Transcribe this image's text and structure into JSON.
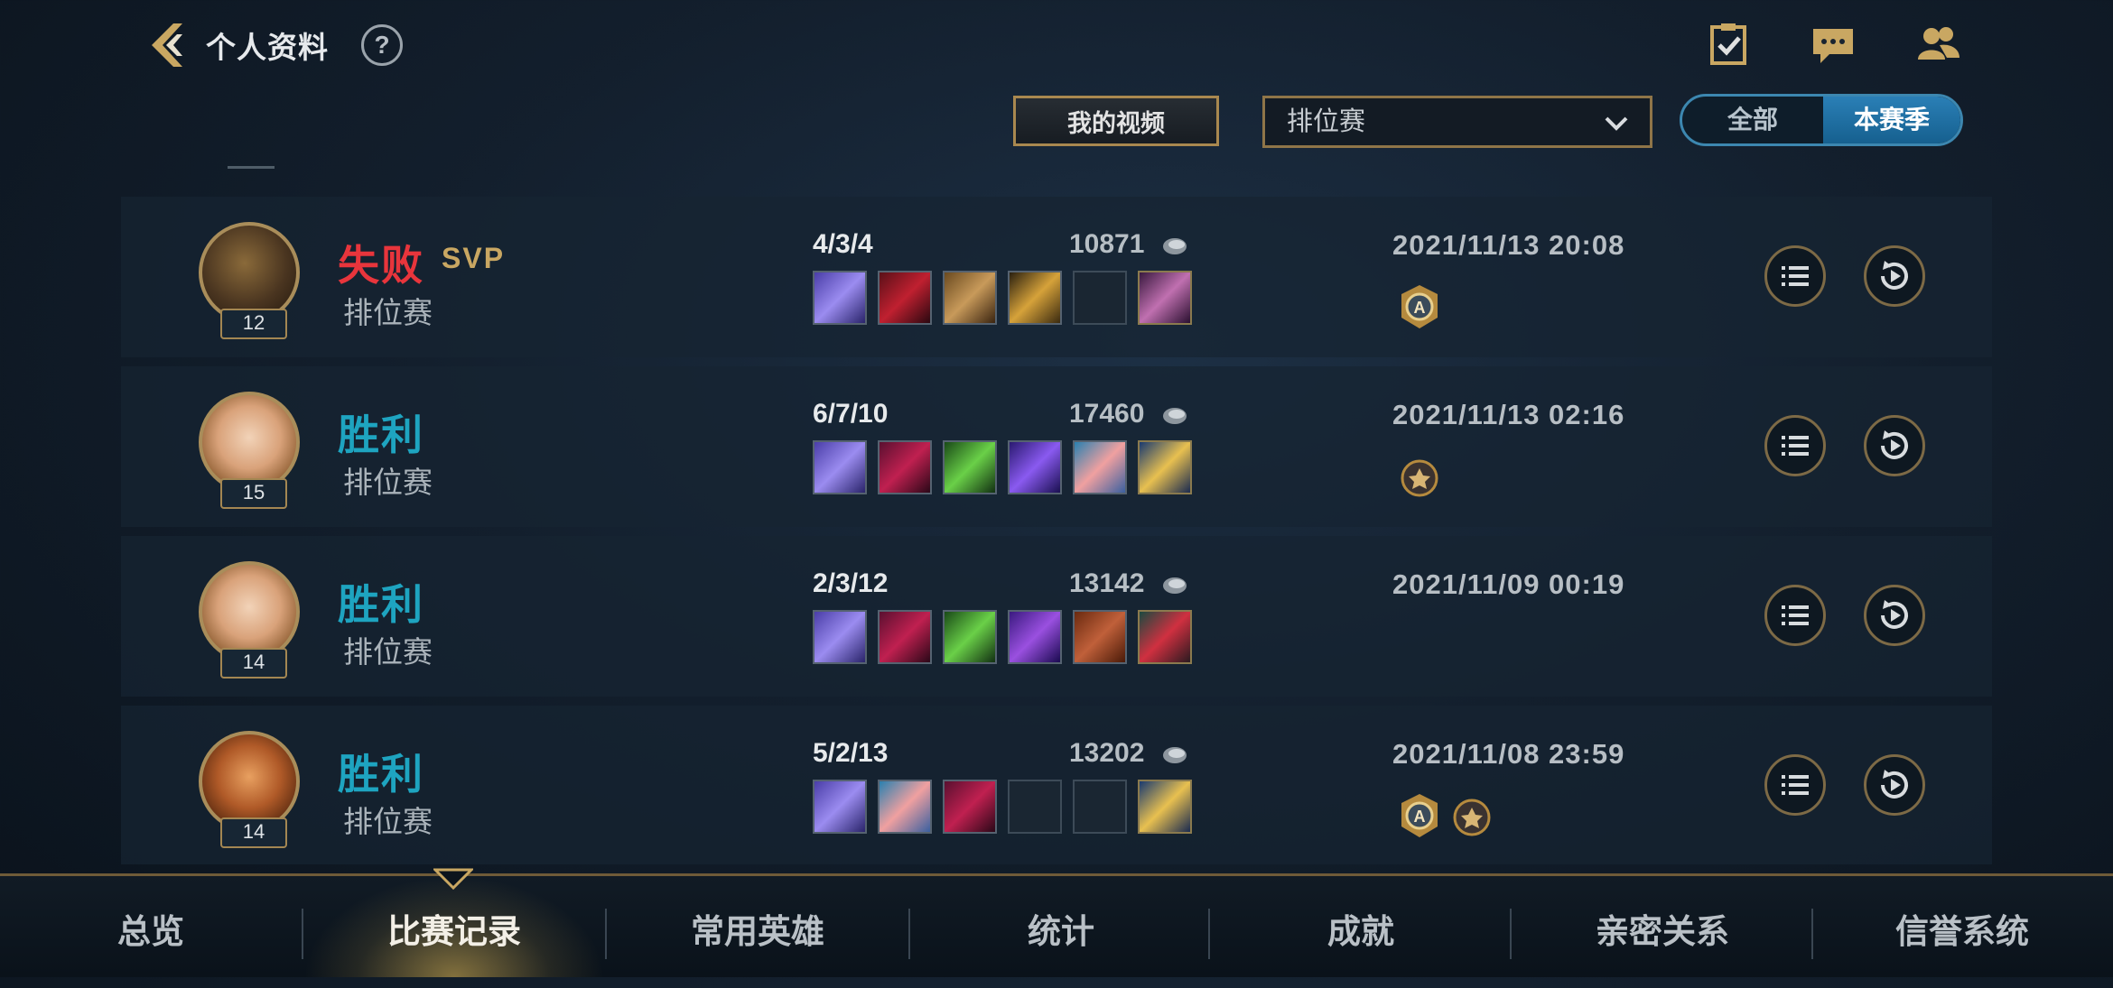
{
  "header": {
    "title": "个人资料",
    "help": "?",
    "my_video": "我的视频",
    "mode_select": "排位赛",
    "toggle": {
      "all": "全部",
      "season": "本赛季",
      "selected": "本赛季"
    }
  },
  "matches": [
    {
      "result": "失败",
      "svp": "SVP",
      "mode": "排位赛",
      "level": "12",
      "kda": "4/3/4",
      "gold": "10871",
      "datetime": "2021/11/13 20:08",
      "badges": [
        "rank-a-badge-icon"
      ]
    },
    {
      "result": "胜利",
      "mode": "排位赛",
      "level": "15",
      "kda": "6/7/10",
      "gold": "17460",
      "datetime": "2021/11/13 02:16",
      "badges": [
        "medal-badge-icon"
      ]
    },
    {
      "result": "胜利",
      "mode": "排位赛",
      "level": "14",
      "kda": "2/3/12",
      "gold": "13142",
      "datetime": "2021/11/09 00:19",
      "badges": []
    },
    {
      "result": "胜利",
      "mode": "排位赛",
      "level": "14",
      "kda": "5/2/13",
      "gold": "13202",
      "datetime": "2021/11/08 23:59",
      "badges": [
        "rank-a-badge-icon",
        "medal-badge-icon"
      ]
    }
  ],
  "bottom_nav": {
    "tabs": [
      "总览",
      "比赛记录",
      "常用英雄",
      "统计",
      "成就",
      "亲密关系",
      "信誉系统"
    ],
    "active": "比赛记录"
  },
  "colors": {
    "win": "#1ea4c0",
    "loss": "#e8353c",
    "gold_accent": "#a9884f",
    "toggle_active": "#2a7fb6"
  }
}
